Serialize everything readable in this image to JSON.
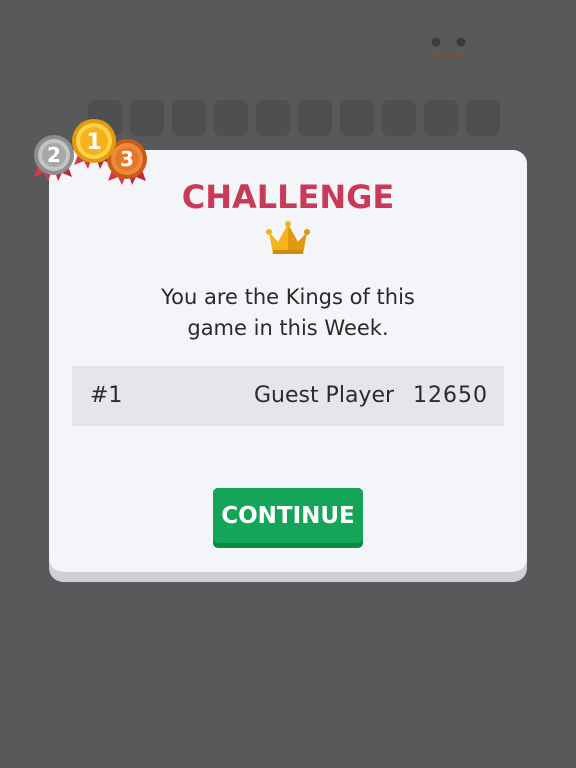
{
  "dialog": {
    "title": "CHALLENGE",
    "message_line1": "You are the Kings of this",
    "message_line2": "game in this Week.",
    "continue_label": "CONTINUE"
  },
  "ranking": {
    "rank": "#1",
    "player": "Guest Player",
    "score": "12650"
  },
  "medals": {
    "first": "1",
    "second": "2",
    "third": "3"
  },
  "icons": {
    "crown": "crown-icon",
    "medals": "medals-icon",
    "face": "face-icon"
  },
  "colors": {
    "background": "#58595b",
    "dialog": "#f4f5f9",
    "title": "#c83b58",
    "button": "#14a558",
    "gold": "#f6b21d",
    "silver": "#a7a8aa",
    "bronze": "#e4792b"
  }
}
